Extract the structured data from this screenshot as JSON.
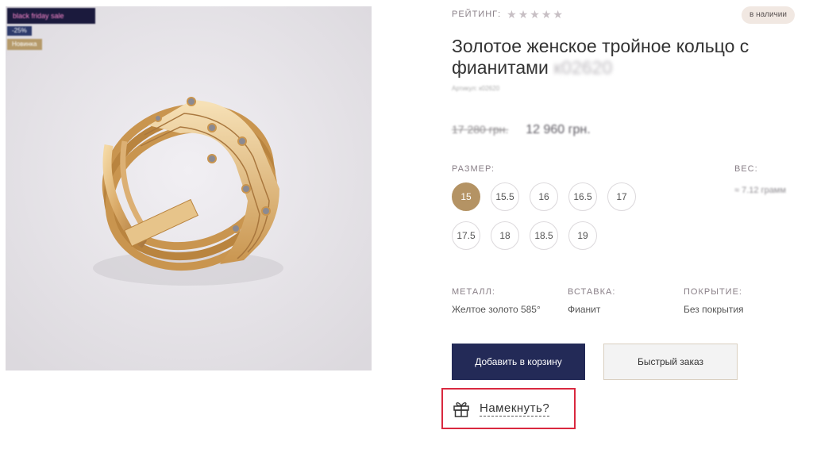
{
  "badges": {
    "sale": "black friday sale",
    "discount": "-25%",
    "new": "Новинка"
  },
  "rating": {
    "label": "РЕЙТИНГ:",
    "stars_filled": 0,
    "stars_total": 5,
    "star_glyph": "★"
  },
  "stock": "в наличии",
  "product": {
    "title": "Золотое женское тройное кольцо с фианитами",
    "sku_in_title": "к02620",
    "article": "Артикул: к02620",
    "old_price": "17 280 грн.",
    "new_price": "12 960 грн."
  },
  "size": {
    "label": "РАЗМЕР:",
    "options": [
      "15",
      "15.5",
      "16",
      "16.5",
      "17",
      "17.5",
      "18",
      "18.5",
      "19"
    ],
    "selected": "15"
  },
  "weight": {
    "label": "ВЕС:",
    "value": "≈ 7.12 грамм"
  },
  "props": {
    "metal_label": "МЕТАЛЛ:",
    "metal_value": "Желтое золото 585°",
    "insert_label": "ВСТАВКА:",
    "insert_value": "Фианит",
    "coating_label": "ПОКРЫТИЕ:",
    "coating_value": "Без покрытия"
  },
  "actions": {
    "add_to_cart": "Добавить в корзину",
    "quick_order": "Быстрый заказ",
    "hint": "Намекнуть?"
  },
  "colors": {
    "accent_gold": "#b49364",
    "primary_navy": "#232a57",
    "highlight_red": "#d9283f",
    "stock_badge_bg": "#f1e8e2"
  },
  "icons": {
    "rating": "star-icon",
    "hint": "gift-icon"
  }
}
